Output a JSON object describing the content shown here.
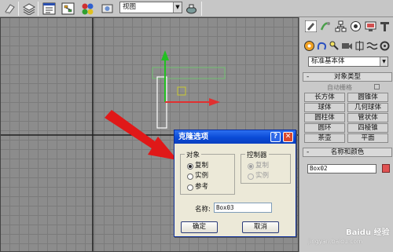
{
  "toolbar": {
    "view_label": "视图",
    "icons": [
      "select-object-icon",
      "layers-icon",
      "curve-editor-icon",
      "schematic-view-icon",
      "material-editor-icon",
      "render-setup-icon",
      "view-dropdown-arrow-icon",
      "quick-render-icon"
    ]
  },
  "command_panel": {
    "tabs_row1": [
      "create-tab-icon",
      "modify-tab-icon",
      "hierarchy-tab-icon",
      "motion-tab-icon",
      "display-tab-icon",
      "utilities-tab-icon"
    ],
    "tabs_row2": [
      "geometry-icon",
      "shapes-icon",
      "lights-icon",
      "cameras-icon",
      "helpers-icon",
      "space-warps-icon",
      "systems-icon"
    ],
    "primitive_type": "标准基本体",
    "object_type_rollout": "对象类型",
    "autogrid_label": "自动栅格",
    "object_buttons": [
      "长方体",
      "圆锥体",
      "球体",
      "几何球体",
      "圆柱体",
      "管状体",
      "圆环",
      "四棱锥",
      "茶壶",
      "平面"
    ],
    "name_color_rollout": "名称和颜色",
    "object_name": "Box02",
    "object_color": "#e05252",
    "rollout_sign": "-"
  },
  "dialog": {
    "title": "克隆选项",
    "help_label": "?",
    "close_label": "✕",
    "object_group_label": "对象",
    "object_options": [
      {
        "label": "复制",
        "checked": true
      },
      {
        "label": "实例",
        "checked": false
      },
      {
        "label": "参考",
        "checked": false
      }
    ],
    "controller_group_label": "控制器",
    "controller_options": [
      {
        "label": "复制",
        "checked": true,
        "disabled": true
      },
      {
        "label": "实例",
        "checked": false,
        "disabled": true
      }
    ],
    "name_label": "名称:",
    "name_value": "Box03",
    "ok_label": "确定",
    "cancel_label": "取消"
  },
  "colors": {
    "gizmo_y": "#22c022",
    "gizmo_x": "#e03030",
    "arrow": "#e01818",
    "selection_box": "#ffffff",
    "box_wire": "#6fbf6f"
  },
  "watermark": {
    "logo": "Baidu 经验",
    "url": "jingyan.baidu.com"
  }
}
